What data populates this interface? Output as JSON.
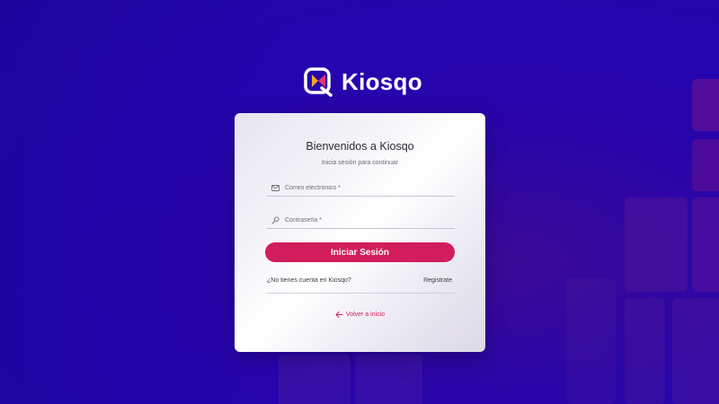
{
  "brand": {
    "name": "Kiosqo",
    "colors": {
      "primary": "#d11d5c",
      "logo_left": "#f5a623",
      "logo_right": "#e8336f",
      "background": "#2405b0"
    }
  },
  "login": {
    "title": "Bienvenidos a Kiosqo",
    "subtitle": "Inicia sesión para continuar",
    "email": {
      "placeholder": "Correo electrónico *",
      "value": "",
      "icon": "mail-icon"
    },
    "password": {
      "placeholder": "Contraseña *",
      "value": "",
      "icon": "key-icon"
    },
    "submit_label": "Iniciar Sesión",
    "no_account_text": "¿No tienes cuenta en Kiosqo?",
    "register_label": "Registrate",
    "back_label": "Volver a inicio",
    "back_icon": "arrow-left-icon"
  }
}
